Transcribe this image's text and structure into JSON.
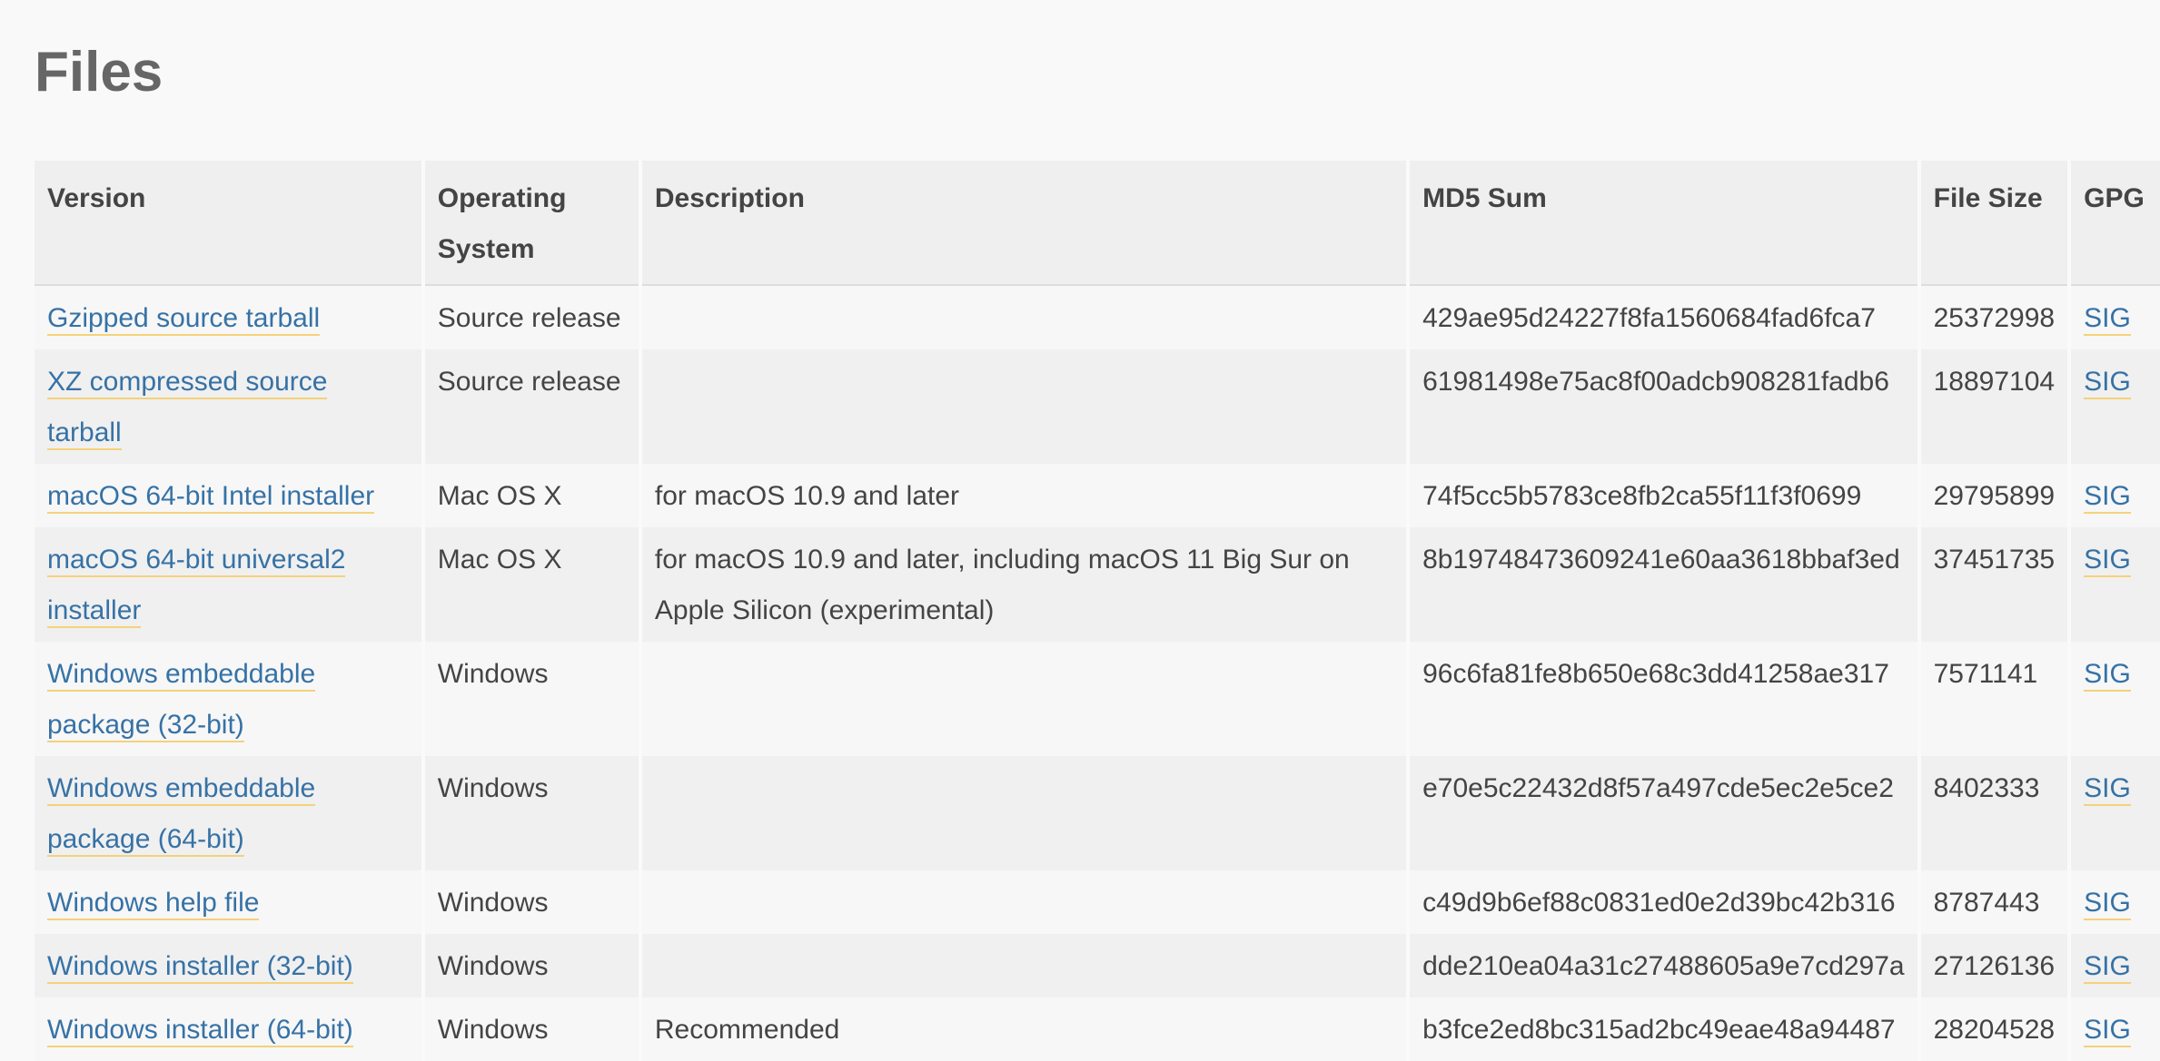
{
  "page": {
    "title": "Files"
  },
  "colors": {
    "link": "#3672a6",
    "link_underline": "#f3d27a",
    "header_bg": "#efefef",
    "row_odd_bg": "#f7f7f7",
    "row_even_bg": "#f0f0f0",
    "text": "#444444",
    "title": "#666666"
  },
  "table": {
    "headers": {
      "version": "Version",
      "os": "Operating System",
      "description": "Description",
      "md5": "MD5 Sum",
      "size": "File Size",
      "gpg": "GPG"
    },
    "rows": [
      {
        "version": "Gzipped source tarball",
        "os": "Source release",
        "description": "",
        "md5": "429ae95d24227f8fa1560684fad6fca7",
        "size": "25372998",
        "gpg": "SIG"
      },
      {
        "version": "XZ compressed source tarball",
        "os": "Source release",
        "description": "",
        "md5": "61981498e75ac8f00adcb908281fadb6",
        "size": "18897104",
        "gpg": "SIG"
      },
      {
        "version": "macOS 64-bit Intel installer",
        "os": "Mac OS X",
        "description": "for macOS 10.9 and later",
        "md5": "74f5cc5b5783ce8fb2ca55f11f3f0699",
        "size": "29795899",
        "gpg": "SIG"
      },
      {
        "version": "macOS 64-bit universal2 installer",
        "os": "Mac OS X",
        "description": "for macOS 10.9 and later, including macOS 11 Big Sur on Apple Silicon (experimental)",
        "md5": "8b19748473609241e60aa3618bbaf3ed",
        "size": "37451735",
        "gpg": "SIG"
      },
      {
        "version": "Windows embeddable package (32-bit)",
        "os": "Windows",
        "description": "",
        "md5": "96c6fa81fe8b650e68c3dd41258ae317",
        "size": "7571141",
        "gpg": "SIG"
      },
      {
        "version": "Windows embeddable package (64-bit)",
        "os": "Windows",
        "description": "",
        "md5": "e70e5c22432d8f57a497cde5ec2e5ce2",
        "size": "8402333",
        "gpg": "SIG"
      },
      {
        "version": "Windows help file",
        "os": "Windows",
        "description": "",
        "md5": "c49d9b6ef88c0831ed0e2d39bc42b316",
        "size": "8787443",
        "gpg": "SIG"
      },
      {
        "version": "Windows installer (32-bit)",
        "os": "Windows",
        "description": "",
        "md5": "dde210ea04a31c27488605a9e7cd297a",
        "size": "27126136",
        "gpg": "SIG"
      },
      {
        "version": "Windows installer (64-bit)",
        "os": "Windows",
        "description": "Recommended",
        "md5": "b3fce2ed8bc315ad2bc49eae48a94487",
        "size": "28204528",
        "gpg": "SIG"
      }
    ]
  }
}
